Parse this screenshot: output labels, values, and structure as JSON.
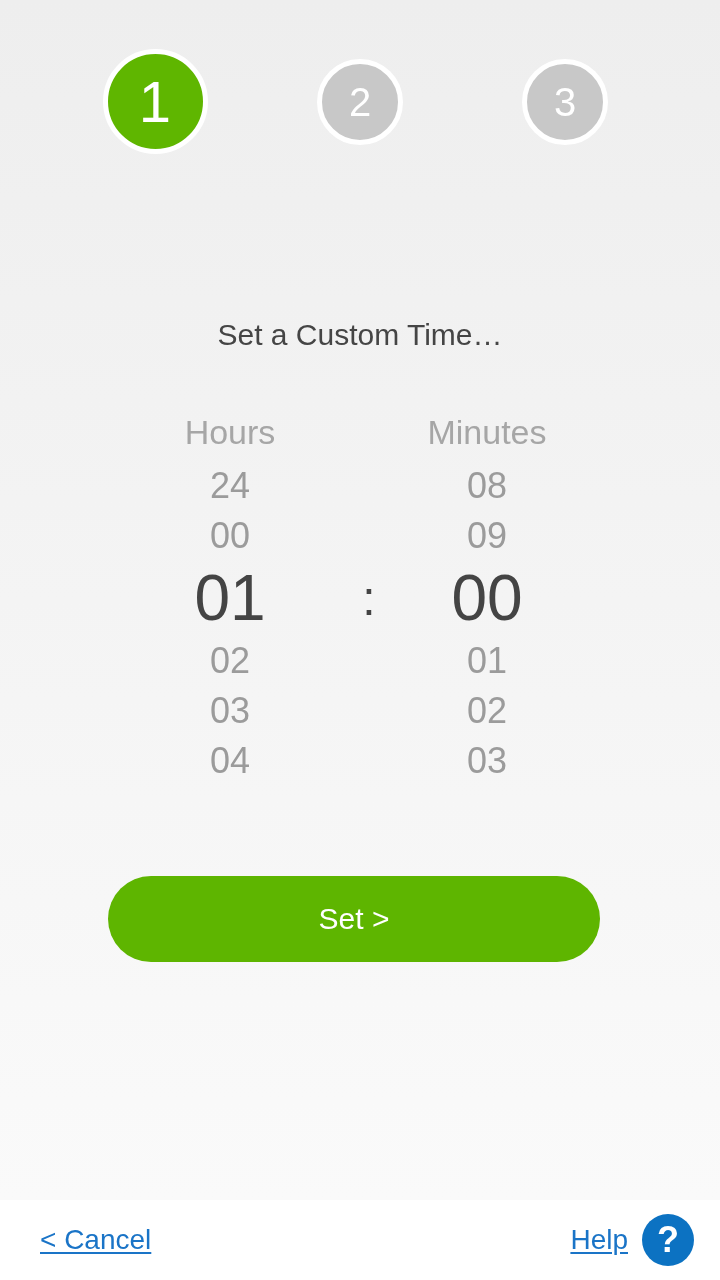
{
  "steps": [
    {
      "label": "1",
      "selected": true
    },
    {
      "label": "2",
      "selected": false
    },
    {
      "label": "3",
      "selected": false
    }
  ],
  "title": "Set a Custom Time…",
  "pickers": [
    {
      "label": "Hours",
      "values": [
        {
          "text": "24",
          "selected": false
        },
        {
          "text": "00",
          "selected": false
        },
        {
          "text": "01",
          "selected": true
        },
        {
          "text": "02",
          "selected": false
        },
        {
          "text": "03",
          "selected": false
        },
        {
          "text": "04",
          "selected": false
        }
      ]
    },
    {
      "label": "Minutes",
      "values": [
        {
          "text": "08",
          "selected": false
        },
        {
          "text": "09",
          "selected": false
        },
        {
          "text": "00",
          "selected": true
        },
        {
          "text": "01",
          "selected": false
        },
        {
          "text": "02",
          "selected": false
        },
        {
          "text": "03",
          "selected": false
        }
      ]
    }
  ],
  "separator": ":",
  "set_button": "Set >",
  "footer": {
    "cancel": "< Cancel",
    "help": "Help",
    "help_icon": "?"
  }
}
